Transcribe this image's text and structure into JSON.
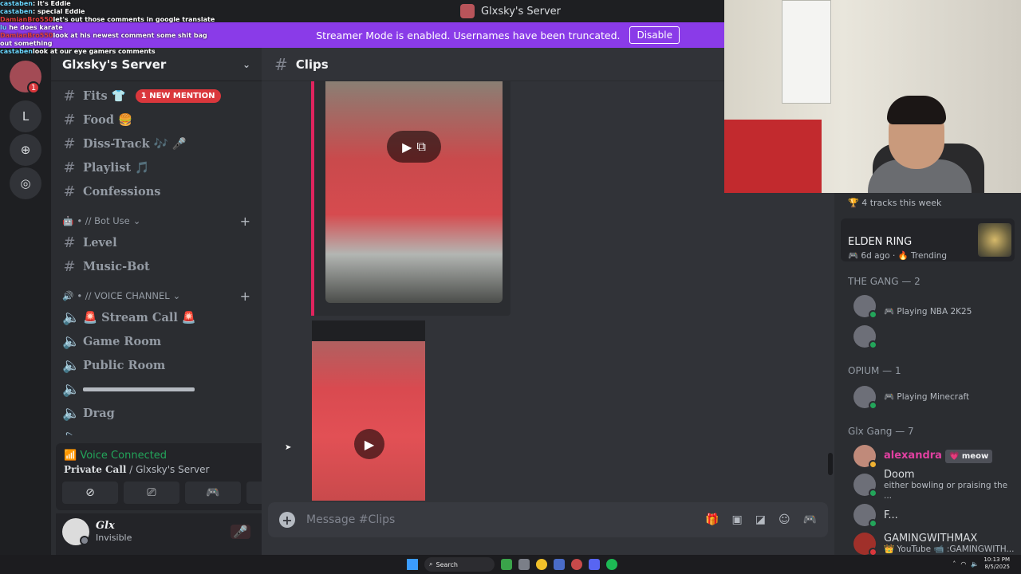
{
  "window": {
    "title": "Glxsky's Server"
  },
  "banner": {
    "text": "Streamer Mode is enabled. Usernames have been truncated.",
    "button": "Disable"
  },
  "overlay_chat": [
    {
      "user": "castaben",
      "text": ": it's Eddie",
      "blue": true
    },
    {
      "user": "castaben",
      "text": ": special Eddie",
      "blue": true
    },
    {
      "user": "DamianBro550",
      "text": "let's out those comments in google translate",
      "blue": false
    },
    {
      "user": "lu",
      "text": " he does karate",
      "blue": true
    },
    {
      "user": "DamianBro550",
      "text": "look at his newest comment some shit bag",
      "blue": false
    },
    {
      "user": "",
      "text": "out something",
      "blue": false
    },
    {
      "user": "castaben",
      "text": "look at our eye gamers comments",
      "blue": true
    }
  ],
  "rail": {
    "mention_count": "1",
    "letter_server": "L"
  },
  "server": {
    "name": "Glxsky's Server"
  },
  "channels": {
    "fits": "Fits 👕",
    "fits_mention": "1 NEW MENTION",
    "food": "Food 🍔",
    "disstrack": "Diss-Track 🎶 🎤",
    "playlist": "Playlist 🎵",
    "confessions": "Confessions",
    "cat_bot": "• // Bot Use",
    "level": "Level",
    "musicbot": "Music-Bot",
    "cat_voice": "• // VOICE CHANNEL",
    "streamcall": "🚨 Stream Call 🚨",
    "gameroom": "Game Room",
    "publicroom": "Public Room",
    "drag": "Drag"
  },
  "voice": {
    "status": "Voice Connected",
    "channel": "Private Call",
    "server": " / Glxsky's Server"
  },
  "user": {
    "name": "Glx",
    "status": "Invisible"
  },
  "chat": {
    "channel": "Clips",
    "placeholder": "Message #Clips"
  },
  "members": {
    "tracks": "4 tracks this week",
    "activity_game": "ELDEN RING",
    "activity_meta": "🎮 6d ago · 🔥 Trending",
    "group_gang": "THE GANG — 2",
    "gang_1_activity": "🎮 Playing NBA 2K25",
    "group_opium": "OPIUM — 1",
    "opium_1_activity": "🎮 Playing Minecraft",
    "group_glx": "Glx Gang — 7",
    "alexandra": "alexandra",
    "alexandra_badge": "💗 meow",
    "doom": "Doom",
    "doom_activity": "either bowling or praising the ...",
    "f": "F...",
    "gwm": "GAMINGWITHMAX",
    "gwm_activity": "👑 YouTube 📹 :GAMINGWITH..."
  },
  "taskbar": {
    "search": "Search",
    "time": "10:13 PM",
    "date": "8/5/2025"
  }
}
